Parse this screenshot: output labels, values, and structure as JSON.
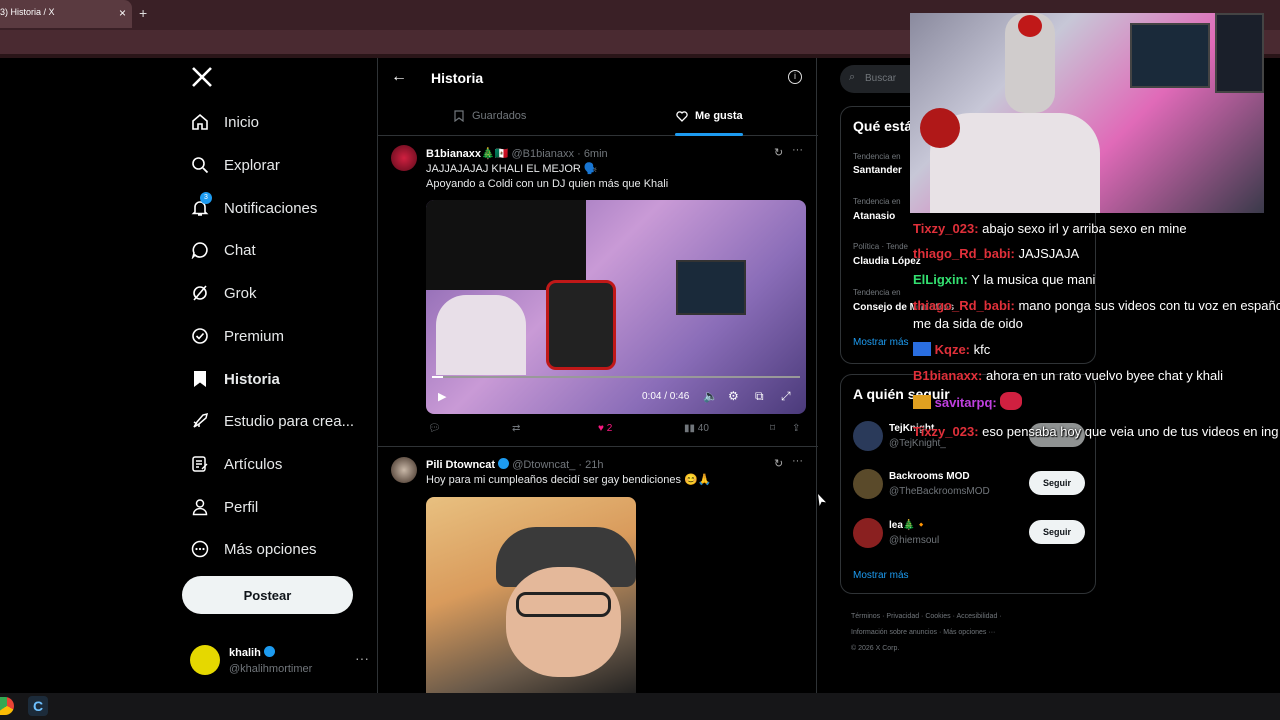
{
  "browser": {
    "tab_title": "3) Historia / X",
    "tab_close": "×",
    "new_tab": "+"
  },
  "sidebar": {
    "logo": "X",
    "items": [
      {
        "label": "Inicio",
        "icon": "home-icon"
      },
      {
        "label": "Explorar",
        "icon": "search-icon"
      },
      {
        "label": "Notificaciones",
        "icon": "bell-icon",
        "badge": "3"
      },
      {
        "label": "Chat",
        "icon": "chat-icon"
      },
      {
        "label": "Grok",
        "icon": "grok-icon"
      },
      {
        "label": "Premium",
        "icon": "premium-icon"
      },
      {
        "label": "Historia",
        "icon": "bookmark-icon",
        "active": true
      },
      {
        "label": "Estudio para crea...",
        "icon": "rocket-icon"
      },
      {
        "label": "Artículos",
        "icon": "article-icon"
      },
      {
        "label": "Perfil",
        "icon": "person-icon"
      },
      {
        "label": "Más opciones",
        "icon": "more-circle-icon"
      }
    ],
    "post_label": "Postear",
    "account": {
      "name": "khalih",
      "handle": "@khalihmortimer",
      "more": "···"
    }
  },
  "main": {
    "title": "Historia",
    "back": "←",
    "tabs": [
      {
        "label": "Guardados",
        "selected": false
      },
      {
        "label": "Me gusta",
        "selected": true
      }
    ],
    "tweets": [
      {
        "name": "B1bianaxx🎄🇲🇽",
        "handle": "@B1bianaxx",
        "time": "· 6min",
        "lines": [
          "JAJJAJAJAJ KHALI EL MEJOR 🗣️",
          "Apoyando a Coldi con un DJ quien más que Khali"
        ],
        "video": {
          "time": "0:04 / 0:46"
        },
        "actions": {
          "likes": "2",
          "views": "40"
        }
      },
      {
        "name": "Pili Dtowncat",
        "handle": "@Dtowncat_",
        "time": "· 21h",
        "lines": [
          "Hoy para mi cumpleaños decidí ser gay bendiciones 😊🙏"
        ]
      }
    ]
  },
  "right": {
    "search_placeholder": "Buscar",
    "trends_title": "Qué está",
    "trends": [
      {
        "meta": "Tendencia en",
        "name": "Santander"
      },
      {
        "meta": "Tendencia en",
        "name": "Atanasio"
      },
      {
        "meta": "Política · Tende",
        "name": "Claudia López"
      },
      {
        "meta": "Tendencia en",
        "name": "Consejo de Ministros"
      }
    ],
    "trends_more": "Mostrar más",
    "who_title": "A quién seguir",
    "who": [
      {
        "name": "TejKnight",
        "handle": "@TejKnight_",
        "button": ""
      },
      {
        "name": "Backrooms MOD",
        "handle": "@TheBackroomsMOD",
        "button": "Seguir"
      },
      {
        "name": "lea🎄🔸",
        "handle": "@hiemsoul",
        "button": "Seguir"
      }
    ],
    "who_more": "Mostrar más",
    "footer": [
      "Términos",
      "Privacidad",
      "Cookies",
      "Accesibilidad",
      "Información sobre anuncios",
      "Más opciones ···",
      "© 2026 X Corp."
    ]
  },
  "chat_overlay": [
    {
      "user": "Tixzy_023:",
      "msg": "abajo sexo irl y arriba sexo en mine",
      "color": "#e0303a"
    },
    {
      "user": "thiago_Rd_babi:",
      "msg": "JAJSJAJA",
      "color": "#e0303a"
    },
    {
      "user": "ElLigxin:",
      "msg": "Y la musica que mani",
      "color": "#33e070"
    },
    {
      "user": "thiago_Rd_babi:",
      "msg": "mano ponga sus videos con tu voz en españo",
      "color": "#e0303a"
    },
    {
      "user": "",
      "msg": "me da sida de oido",
      "color": "#e0303a"
    },
    {
      "user": "Kqze:",
      "msg": "kfc",
      "color": "#e0303a"
    },
    {
      "user": "B1bianaxx:",
      "msg": "ahora en un rato vuelvo byee chat y khali",
      "color": "#e0303a"
    },
    {
      "user": "savitarpq:",
      "msg": "",
      "color": "#c040e0"
    },
    {
      "user": "Tixzy_023:",
      "msg": "eso pensaba hoy que veia uno de tus videos en ing",
      "color": "#e0303a"
    }
  ],
  "colors": {
    "accent": "#1d9bf0",
    "like": "#f91880"
  },
  "taskbar": {
    "app2": "C"
  }
}
